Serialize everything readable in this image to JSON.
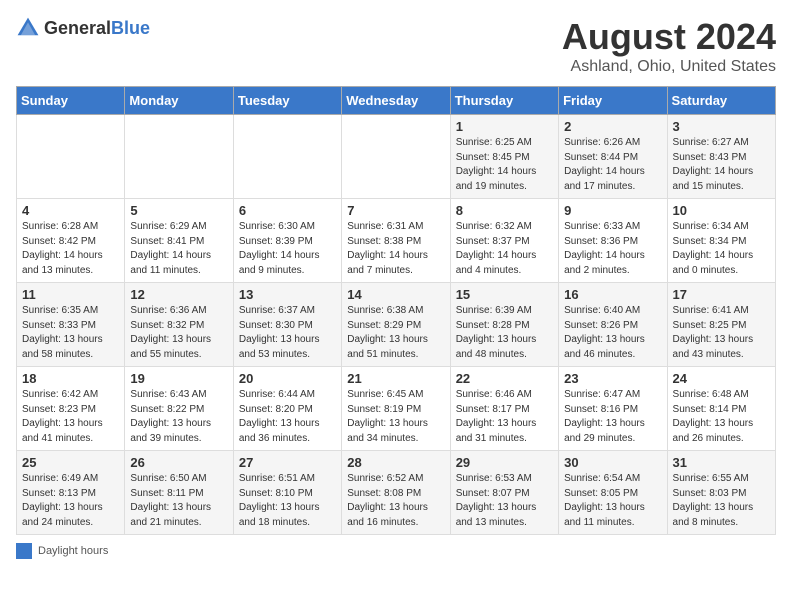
{
  "logo": {
    "general": "General",
    "blue": "Blue"
  },
  "title": "August 2024",
  "subtitle": "Ashland, Ohio, United States",
  "weekdays": [
    "Sunday",
    "Monday",
    "Tuesday",
    "Wednesday",
    "Thursday",
    "Friday",
    "Saturday"
  ],
  "legend_label": "Daylight hours",
  "weeks": [
    [
      {
        "day": "",
        "info": ""
      },
      {
        "day": "",
        "info": ""
      },
      {
        "day": "",
        "info": ""
      },
      {
        "day": "",
        "info": ""
      },
      {
        "day": "1",
        "info": "Sunrise: 6:25 AM\nSunset: 8:45 PM\nDaylight: 14 hours\nand 19 minutes."
      },
      {
        "day": "2",
        "info": "Sunrise: 6:26 AM\nSunset: 8:44 PM\nDaylight: 14 hours\nand 17 minutes."
      },
      {
        "day": "3",
        "info": "Sunrise: 6:27 AM\nSunset: 8:43 PM\nDaylight: 14 hours\nand 15 minutes."
      }
    ],
    [
      {
        "day": "4",
        "info": "Sunrise: 6:28 AM\nSunset: 8:42 PM\nDaylight: 14 hours\nand 13 minutes."
      },
      {
        "day": "5",
        "info": "Sunrise: 6:29 AM\nSunset: 8:41 PM\nDaylight: 14 hours\nand 11 minutes."
      },
      {
        "day": "6",
        "info": "Sunrise: 6:30 AM\nSunset: 8:39 PM\nDaylight: 14 hours\nand 9 minutes."
      },
      {
        "day": "7",
        "info": "Sunrise: 6:31 AM\nSunset: 8:38 PM\nDaylight: 14 hours\nand 7 minutes."
      },
      {
        "day": "8",
        "info": "Sunrise: 6:32 AM\nSunset: 8:37 PM\nDaylight: 14 hours\nand 4 minutes."
      },
      {
        "day": "9",
        "info": "Sunrise: 6:33 AM\nSunset: 8:36 PM\nDaylight: 14 hours\nand 2 minutes."
      },
      {
        "day": "10",
        "info": "Sunrise: 6:34 AM\nSunset: 8:34 PM\nDaylight: 14 hours\nand 0 minutes."
      }
    ],
    [
      {
        "day": "11",
        "info": "Sunrise: 6:35 AM\nSunset: 8:33 PM\nDaylight: 13 hours\nand 58 minutes."
      },
      {
        "day": "12",
        "info": "Sunrise: 6:36 AM\nSunset: 8:32 PM\nDaylight: 13 hours\nand 55 minutes."
      },
      {
        "day": "13",
        "info": "Sunrise: 6:37 AM\nSunset: 8:30 PM\nDaylight: 13 hours\nand 53 minutes."
      },
      {
        "day": "14",
        "info": "Sunrise: 6:38 AM\nSunset: 8:29 PM\nDaylight: 13 hours\nand 51 minutes."
      },
      {
        "day": "15",
        "info": "Sunrise: 6:39 AM\nSunset: 8:28 PM\nDaylight: 13 hours\nand 48 minutes."
      },
      {
        "day": "16",
        "info": "Sunrise: 6:40 AM\nSunset: 8:26 PM\nDaylight: 13 hours\nand 46 minutes."
      },
      {
        "day": "17",
        "info": "Sunrise: 6:41 AM\nSunset: 8:25 PM\nDaylight: 13 hours\nand 43 minutes."
      }
    ],
    [
      {
        "day": "18",
        "info": "Sunrise: 6:42 AM\nSunset: 8:23 PM\nDaylight: 13 hours\nand 41 minutes."
      },
      {
        "day": "19",
        "info": "Sunrise: 6:43 AM\nSunset: 8:22 PM\nDaylight: 13 hours\nand 39 minutes."
      },
      {
        "day": "20",
        "info": "Sunrise: 6:44 AM\nSunset: 8:20 PM\nDaylight: 13 hours\nand 36 minutes."
      },
      {
        "day": "21",
        "info": "Sunrise: 6:45 AM\nSunset: 8:19 PM\nDaylight: 13 hours\nand 34 minutes."
      },
      {
        "day": "22",
        "info": "Sunrise: 6:46 AM\nSunset: 8:17 PM\nDaylight: 13 hours\nand 31 minutes."
      },
      {
        "day": "23",
        "info": "Sunrise: 6:47 AM\nSunset: 8:16 PM\nDaylight: 13 hours\nand 29 minutes."
      },
      {
        "day": "24",
        "info": "Sunrise: 6:48 AM\nSunset: 8:14 PM\nDaylight: 13 hours\nand 26 minutes."
      }
    ],
    [
      {
        "day": "25",
        "info": "Sunrise: 6:49 AM\nSunset: 8:13 PM\nDaylight: 13 hours\nand 24 minutes."
      },
      {
        "day": "26",
        "info": "Sunrise: 6:50 AM\nSunset: 8:11 PM\nDaylight: 13 hours\nand 21 minutes."
      },
      {
        "day": "27",
        "info": "Sunrise: 6:51 AM\nSunset: 8:10 PM\nDaylight: 13 hours\nand 18 minutes."
      },
      {
        "day": "28",
        "info": "Sunrise: 6:52 AM\nSunset: 8:08 PM\nDaylight: 13 hours\nand 16 minutes."
      },
      {
        "day": "29",
        "info": "Sunrise: 6:53 AM\nSunset: 8:07 PM\nDaylight: 13 hours\nand 13 minutes."
      },
      {
        "day": "30",
        "info": "Sunrise: 6:54 AM\nSunset: 8:05 PM\nDaylight: 13 hours\nand 11 minutes."
      },
      {
        "day": "31",
        "info": "Sunrise: 6:55 AM\nSunset: 8:03 PM\nDaylight: 13 hours\nand 8 minutes."
      }
    ]
  ]
}
